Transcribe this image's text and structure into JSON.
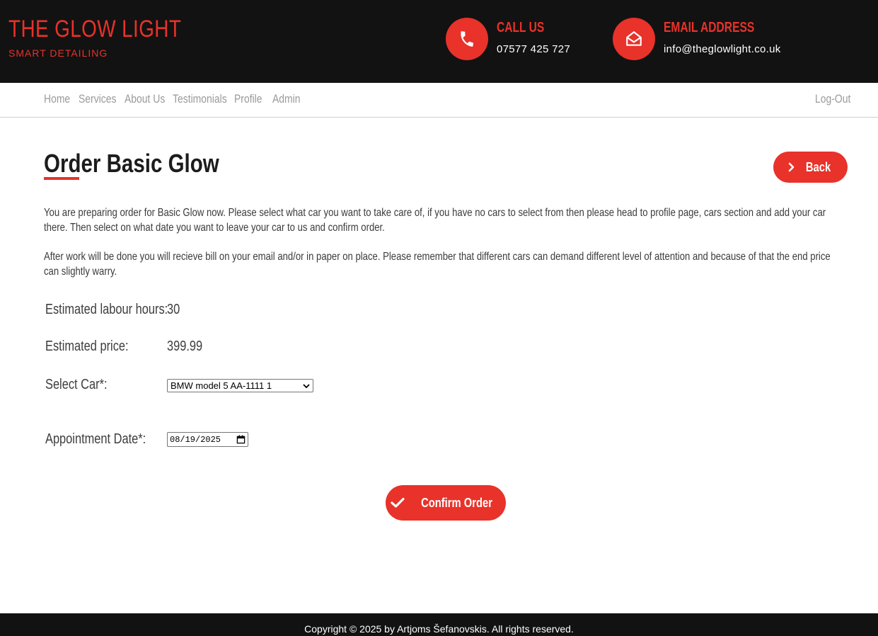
{
  "header": {
    "brand_title": "THE GLOW LIGHT",
    "brand_subtitle": "SMART DETAILING",
    "call": {
      "title": "CALL US",
      "value": "07577 425 727",
      "icon": "phone-icon"
    },
    "email": {
      "title": "EMAIL ADDRESS",
      "value": "info@theglowlight.co.uk",
      "icon": "envelope-open-icon"
    }
  },
  "nav": {
    "items": [
      "Home",
      "Services",
      "About Us",
      "Testimonials",
      "Profile",
      "Admin"
    ],
    "logout": "Log-Out"
  },
  "main": {
    "title": "Order Basic Glow",
    "back_label": "Back",
    "back_icon": "chevron-right-icon",
    "paragraph1": "You are preparing order for Basic Glow now. Please select what car you want to take care of, if you have no cars to select from then please head to profile page, cars section and add your car there. Then select on what date you want to leave your car to us and confirm order.",
    "paragraph2": "After work will be done you will recieve bill on your email and/or in paper on place. Please remember that different cars can demand different level of attention and because of that the end price can slightly warry.",
    "labour_label": "Estimated labour hours:",
    "labour_value": "30",
    "price_label": "Estimated price:",
    "price_value": "399.99",
    "car_label": "Select Car*:",
    "car_selected": "BMW model 5 AA-1111 1",
    "date_label": "Appointment Date*:",
    "date_value": "08/19/2025",
    "confirm_label": "Confirm Order",
    "confirm_icon": "checkmark-icon"
  },
  "footer": {
    "copyright": "Copyright © 2025 by Artjoms Šefanovskis. All rights reserved."
  },
  "colors": {
    "accent": "#e8322a",
    "dark": "#121212",
    "nav_text": "#9a9a9a"
  }
}
